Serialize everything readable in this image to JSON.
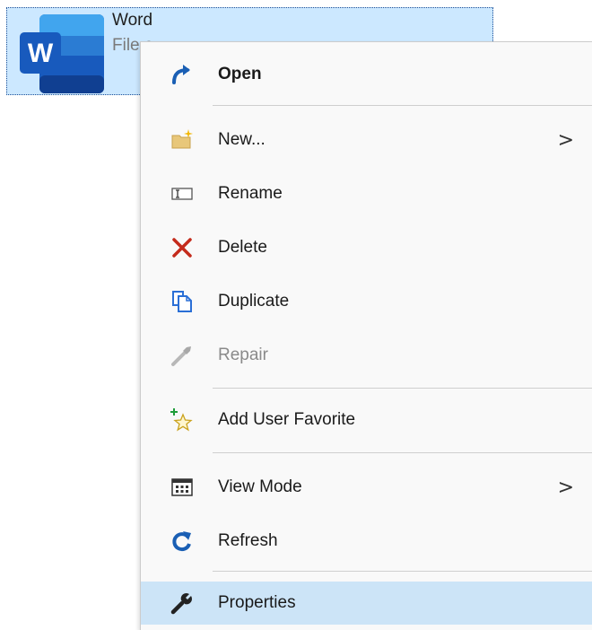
{
  "file": {
    "title": "Word",
    "subtitle": "File c",
    "icon": "word-app-icon",
    "selection_color": "#cce8ff"
  },
  "menu": {
    "items": [
      {
        "label": "Open",
        "icon": "open-arrow-icon"
      },
      {
        "label": "New...",
        "icon": "new-folder-icon",
        "arrow": ">"
      },
      {
        "label": "Rename",
        "icon": "rename-icon"
      },
      {
        "label": "Delete",
        "icon": "delete-x-icon"
      },
      {
        "label": "Duplicate",
        "icon": "duplicate-icon"
      },
      {
        "label": "Repair",
        "icon": "repair-wrench-icon"
      },
      {
        "label": "Add User Favorite",
        "icon": "add-favorite-star-icon"
      },
      {
        "label": "View Mode",
        "icon": "view-mode-icon",
        "arrow": ">"
      },
      {
        "label": "Refresh",
        "icon": "refresh-icon"
      },
      {
        "label": "Properties",
        "icon": "properties-wrench-icon"
      }
    ],
    "highlight_color": "#cce4f7"
  }
}
